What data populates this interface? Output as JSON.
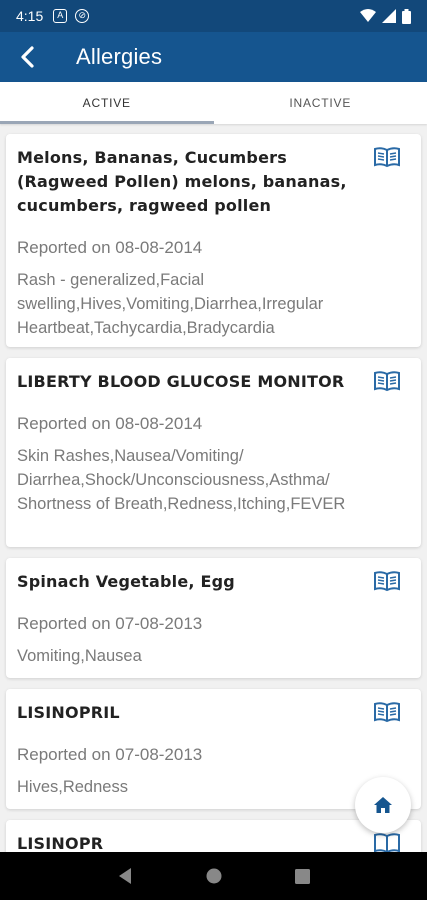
{
  "status_bar": {
    "time": "4:15"
  },
  "header": {
    "title": "Allergies"
  },
  "tabs": [
    {
      "label": "ACTIVE",
      "active": true
    },
    {
      "label": "INACTIVE",
      "active": false
    }
  ],
  "allergies": [
    {
      "title": "Melons, Bananas, Cucumbers (Ragweed Pollen) melons, bananas, cucumbers, ragweed pollen",
      "reported": "Reported on 08-08-2014",
      "reactions": "Rash - generalized,Facial swelling,Hives,Vomiting,Diarrhea,Irregular Heartbeat,Tachycardia,Bradycardia"
    },
    {
      "title": "LIBERTY BLOOD GLUCOSE MONITOR",
      "reported": "Reported on 08-08-2014",
      "reactions": "Skin Rashes,Nausea/Vomiting/ Diarrhea,Shock/Unconsciousness,Asthma/ Shortness of Breath,Redness,Itching,FEVER"
    },
    {
      "title": "Spinach Vegetable, Egg",
      "reported": "Reported on 07-08-2013",
      "reactions": "Vomiting,Nausea"
    },
    {
      "title": "LISINOPRIL",
      "reported": "Reported on 07-08-2013",
      "reactions": "Hives,Redness"
    },
    {
      "title": "LISINOPR",
      "reported": "",
      "reactions": ""
    }
  ],
  "colors": {
    "status_bar": "#12487a",
    "app_bar": "#15558f",
    "icon_blue": "#2a6aa6"
  },
  "icons": {
    "back": "back-arrow-icon",
    "book": "book-icon",
    "home": "home-icon"
  }
}
